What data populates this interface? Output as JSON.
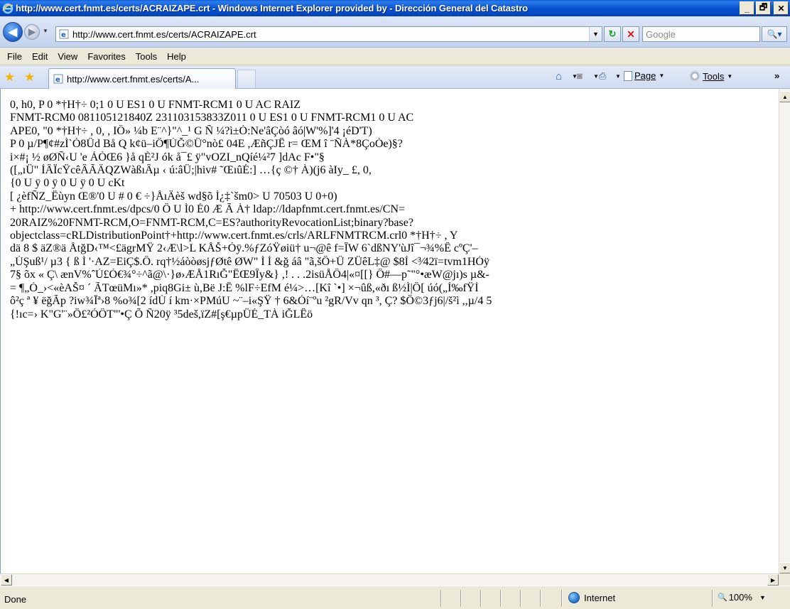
{
  "window": {
    "title": "http://www.cert.fnmt.es/certs/ACRAIZAPE.crt - Windows Internet Explorer provided by  - Dirección General del Catastro",
    "minimize_label": "_",
    "maximize_label": "🗗",
    "close_label": "✕"
  },
  "navigation": {
    "back_glyph": "◀",
    "forward_glyph": "▶",
    "dropdown_glyph": "▼",
    "address_value": "http://www.cert.fnmt.es/certs/ACRAIZAPE.crt",
    "refresh_glyph": "↻",
    "stop_glyph": "✕",
    "search_placeholder": "Google",
    "search_glyph": "🔍▾"
  },
  "menu": {
    "items": [
      "File",
      "Edit",
      "View",
      "Favorites",
      "Tools",
      "Help"
    ]
  },
  "tabs": {
    "favorites_glyph": "★",
    "add_favorites_glyph": "★",
    "active_tab_label": "http://www.cert.fnmt.es/certs/A..."
  },
  "commandbar": {
    "home_glyph": "⌂",
    "feeds_glyph": "◙",
    "print_glyph": "⎙",
    "page_label": "Page",
    "tools_label": "Tools",
    "more_glyph": "»"
  },
  "content": {
    "lines": [
      "0, h0, P             0   *†H†÷      0;1 0   U     ES1 0     U   FNMT-RCM1 0     U   AC RAIZ",
      "FNMT-RCM0   081105121840Z  231103153833Z011 0   U     ES1 0     U   FNMT-RCM1 0   U   AC",
      "APE0, \"0   *†H†÷      ,   0,   ,   IÔ» ¼b E¨^}\"^_¹ G     Ñ  ¼?ì±Ò:Ne'âÇòó âó|W'%]'4 ¡éD'T)",
      "P 0 µ/P¶¢#zÌ`Ó8Ûd Bå Q k¢ü–iÔ¶ÚĞ©Ü°nò£   04E ,ÆñÇJÊ r= ŒM î ¨ÑÀ*8ÇoÒe)§?",
      "i×#¡ ½ øØÑ‹U 'e ÁÒŒ6 }å qÈ²J  ók å¯£ ÿ\"vOZI_nQíé¼²7 ]dAc F•\"§",
      "([„ıÜ\" ÍÂÏcŸcêÂÃÄQZWàßıÂµ ‹  ú:âÜ;|hiv# ˜ŒıûÉ:] …{ç ©† À)(j6 àIy_    £,   0, ",
      "{0    U     ÿ   0    ÿ   0    U     ÿ       0    U        cKt",
      "[ ¿èfÑZ_Ëùyn Œ®'0    U  #   0 € ÷}ÅıÄèš wd§õ  Ì¿‡`šm0>   U   70503   U   0+0)",
      "  +           http://www.cert.fnmt.es/dpcs/0 Ô   U     Ì0 É0 Æ  Ã  À†  ldap://ldapfnmt.cert.fnmt.es/CN=",
      "20RAIZ%20FNMT-RCM,O=FNMT-RCM,C=ES?authorityRevocationList;binary?base?",
      "objectclass=cRLDistributionPoint†+http://www.cert.fnmt.es/crls/ARLFNMTRCM.crl0   *†H†÷      ,   Y",
      "dä 8 $ äZ®ä ÅtğD‹™<£ägrMŸ 2‹Æ\\l>L  KÅŠ+Óÿ.%ƒZóŸøiü† u¬@ê  f=ÎW  6`dßNY'ùJî¯¬¾%Ê cºÇ'–",
      "„ÙŞuß¹/ µ3 {  ß Ì '·AZ=EiÇ$.Ô. rq†½áòòøsjƒØtê ØW\"  Ì Í &ğ áâ \"ã,šÔ+Û ZÜêL‡@ $8Í <³⁄42ï=tvm1HÓÿ",
      "7§ õx «  Ç\\ ænV%ˆÚ£Ó€¾°÷^ã@\\·}ø›ÆÅ1RıĞ\"ËŒ9Îy&} ,! . . .2isüÅÔ4|«¤[[} Ô#—p˜\"°•æW@jı)s µ&-",
      "= ¶„Ó_›<«èAŠ¤ ´ ÃTœüMı»* ,piq8Gi± ù,Bë J:Ë %lF÷EfM é¼>…[Kî `•] ×¬ûß,«ðı ß½Ì|Ô[ úó(„Í‰fŸÍ",
      "ô²ç ª ¥ ëğÃp ?iw¾Īª›8 %o¾[2 ídÙ í km·×PMúU ~¨–i«ŞŸ † 6&Óí¨ºu  ²gR/Vv qn ³,  Ç? $Ö©3ƒj6|/š²ì ,,µ/4 5",
      "{!ıc=› K\"G'¨»Ö£²ÓÔT\"'•Ç Õ Ñ20ÿ ³5deš,ïZ#[ş€µpÜÉ_TÀ iĞLÊö "
    ]
  },
  "scrollbars": {
    "up_glyph": "▲",
    "down_glyph": "▼",
    "left_glyph": "◀",
    "right_glyph": "▶"
  },
  "status": {
    "text": "Done",
    "zone": "Internet",
    "zoom": "100%",
    "zoom_dropdown": "▼"
  }
}
